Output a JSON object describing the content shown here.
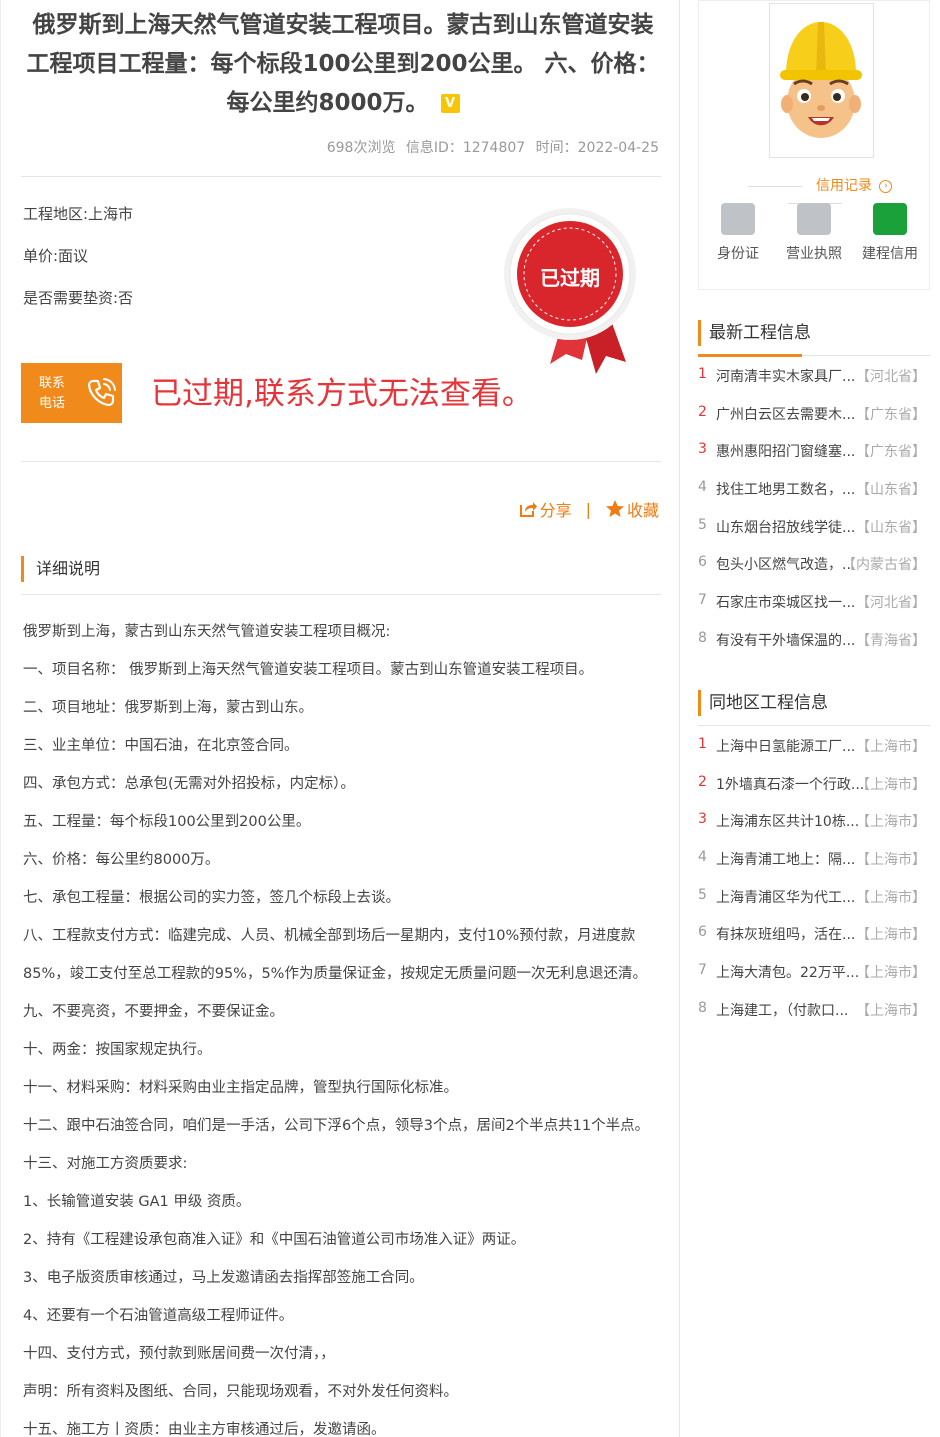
{
  "project": {
    "title": "俄罗斯到上海天然气管道安装工程项目。蒙古到山东管道安装工程项目工程量：每个标段100公里到200公里。 六、价格：每公里约8000万。",
    "verified_badge": "V",
    "views": "698次浏览",
    "info_id": "信息ID：1274807",
    "time": "时间：2022-04-25",
    "region": "工程地区:上海市",
    "unit_price": "单价:面议",
    "advance": "是否需要垫资:否",
    "seal_text": "已过期",
    "contact_label": "联系电话",
    "expired_message": "已过期,联系方式无法查看。",
    "share_label": "分享",
    "separator": "|",
    "favorite_label": "收藏"
  },
  "detail": {
    "heading": "详细说明",
    "lines": [
      "俄罗斯到上海，蒙古到山东天然气管道安装工程项目概况:",
      "一、项目名称： 俄罗斯到上海天然气管道安装工程项目。蒙古到山东管道安装工程项目。",
      "二、项目地址：俄罗斯到上海，蒙古到山东。",
      "三、业主单位：中国石油，在北京签合同。",
      "四、承包方式：总承包(无需对外招投标，内定标）。",
      "五、工程量：每个标段100公里到200公里。",
      "六、价格：每公里约8000万。",
      "七、承包工程量：根据公司的实力签，签几个标段上去谈。",
      "八、工程款支付方式：临建完成、人员、机械全部到场后一星期内，支付10%预付款，月进度款85%，竣工支付至总工程款的95%，5%作为质量保证金，按规定无质量问题一次无利息退还清。",
      "九、不要亮资，不要押金，不要保证金。",
      "十、两金：按国家规定执行。",
      "十一、材料采购：材料采购由业主指定品牌，管型执行国际化标准。",
      "十二、跟中石油签合同，咱们是一手活，公司下浮6个点，领导3个点，居间2个半点共11个半点。",
      "十三、对施工方资质要求:",
      "1、长输管道安装 GA1 甲级 资质。",
      "2、持有《工程建设承包商准入证》和《中国石油管道公司市场准入证》两证。",
      "3、电子版资质审核通过，马上发邀请函去指挥部签施工合同。",
      "4、还要有一个石油管道高级工程师证件。",
      "十四、支付方式，预付款到账居间费一次付清，，",
      "声明：所有资料及图纸、合同，只能现场观看，不对外发任何资料。",
      "十五、施工方丨资质：由业主方审核通过后，发邀请函。"
    ]
  },
  "sidebar": {
    "credit_title": "信用记录",
    "credit_items": [
      {
        "label": "身份证",
        "icon": "id-card-icon"
      },
      {
        "label": "营业执照",
        "icon": "business-license-icon"
      },
      {
        "label": "建程信用",
        "icon": "credit-icon"
      }
    ],
    "latest": {
      "heading": "最新工程信息",
      "items": [
        {
          "n": "1",
          "text": "河南清丰实木家具厂...",
          "region": "【河北省】"
        },
        {
          "n": "2",
          "text": "广州白云区去需要木...",
          "region": "【广东省】"
        },
        {
          "n": "3",
          "text": "惠州惠阳招门窗缝塞...",
          "region": "【广东省】"
        },
        {
          "n": "4",
          "text": "找住工地男工数名，...",
          "region": "【山东省】"
        },
        {
          "n": "5",
          "text": "山东烟台招放线学徒...",
          "region": "【山东省】"
        },
        {
          "n": "6",
          "text": "包头小区燃气改造，...",
          "region": "【内蒙古省】"
        },
        {
          "n": "7",
          "text": "石家庄市栾城区找一...",
          "region": "【河北省】"
        },
        {
          "n": "8",
          "text": "有没有干外墙保温的...",
          "region": "【青海省】"
        }
      ]
    },
    "same_region": {
      "heading": "同地区工程信息",
      "items": [
        {
          "n": "1",
          "text": "上海中日氢能源工厂...",
          "region": "【上海市】"
        },
        {
          "n": "2",
          "text": "1外墙真石漆一个行政...",
          "region": "【上海市】"
        },
        {
          "n": "3",
          "text": "上海浦东区共计10栋...",
          "region": "【上海市】"
        },
        {
          "n": "4",
          "text": "上海青浦工地上：隔...",
          "region": "【上海市】"
        },
        {
          "n": "5",
          "text": "上海青浦区华为代工...",
          "region": "【上海市】"
        },
        {
          "n": "6",
          "text": "有抹灰班组吗，活在...",
          "region": "【上海市】"
        },
        {
          "n": "7",
          "text": "上海大清包。22万平...",
          "region": "【上海市】"
        },
        {
          "n": "8",
          "text": "上海建工，（付款口...",
          "region": "【上海市】"
        }
      ]
    }
  },
  "colors": {
    "accent": "#f08a1a",
    "expired_red": "#e5353a",
    "seal_red": "#d9262c",
    "verified_yellow": "#f7c600",
    "credit_green": "#1aa13a"
  }
}
